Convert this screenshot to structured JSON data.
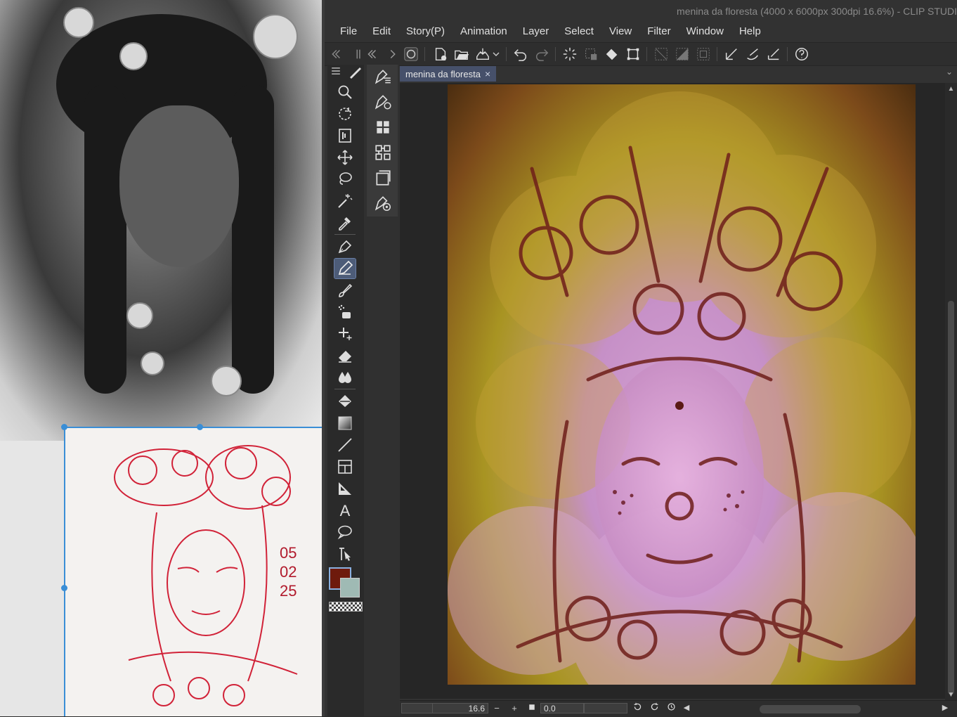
{
  "window": {
    "title": "menina da floresta (4000 x 6000px 300dpi 16.6%)  - CLIP STUDI"
  },
  "menu": [
    "File",
    "Edit",
    "Story(P)",
    "Animation",
    "Layer",
    "Select",
    "View",
    "Filter",
    "Window",
    "Help"
  ],
  "document_tab": {
    "label": "menina da floresta",
    "close_glyph": "×"
  },
  "reference": {
    "sketch_numbers": [
      "05",
      "02",
      "25"
    ]
  },
  "status_bar": {
    "zoom": "16.6",
    "rotation": "0.0",
    "zoom_out": "−",
    "zoom_in": "+"
  },
  "colors": {
    "main_color": "#6e1a0c",
    "sub_color": "#9fbab4",
    "active_tool_highlight": "#4d5c78",
    "selection_blue": "#3a8ed6"
  },
  "tools": [
    "zoom-icon",
    "rotate-icon",
    "layer-move-icon",
    "move-icon",
    "lasso-icon",
    "magic-wand-icon",
    "eyedropper-icon",
    "pen-icon",
    "pencil-icon",
    "brush-icon",
    "airbrush-icon",
    "decoration-icon",
    "eraser-icon",
    "blend-icon",
    "fill-icon",
    "gradient-icon",
    "line-icon",
    "frame-icon",
    "ruler-icon",
    "text-icon",
    "balloon-icon",
    "correct-line-icon"
  ],
  "subtools": [
    "pen-subtool-1-icon",
    "pen-subtool-2-icon",
    "grid-icon",
    "nodes-icon",
    "layer-icon",
    "pen-target-icon"
  ]
}
